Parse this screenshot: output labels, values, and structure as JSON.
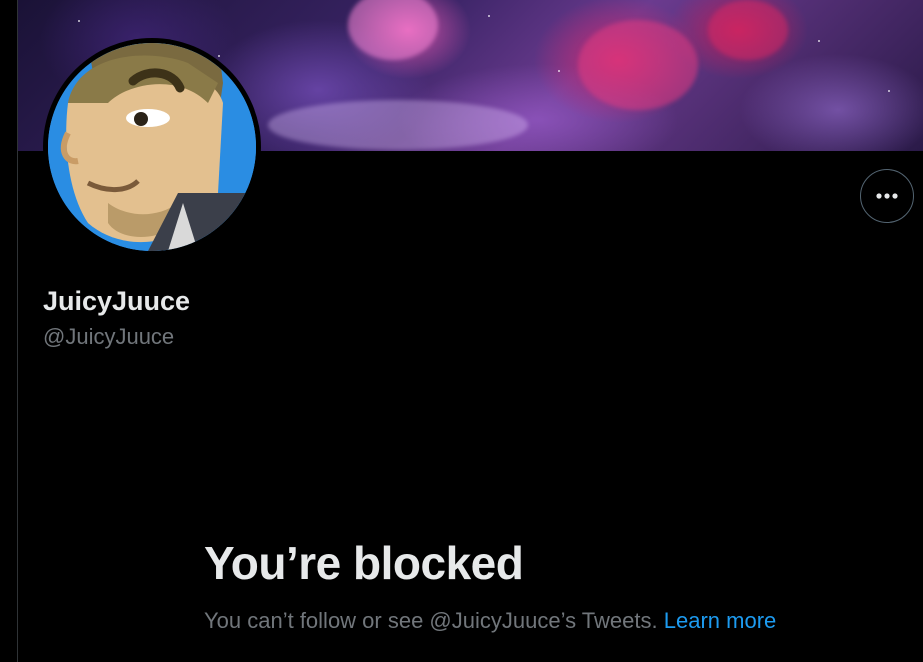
{
  "profile": {
    "display_name": "JuicyJuuce",
    "handle": "@JuicyJuuce"
  },
  "header": {
    "banner": "space-nebula-banner",
    "more_button_icon": "more-horizontal-icon"
  },
  "blocked": {
    "title": "You’re blocked",
    "message": "You can’t follow or see @JuicyJuuce’s Tweets.",
    "link_label": "Learn more"
  },
  "colors": {
    "background": "#000000",
    "primary_text": "#e7e9ea",
    "secondary_text": "#71767b",
    "link": "#1d9bf0",
    "border": "#536471"
  }
}
